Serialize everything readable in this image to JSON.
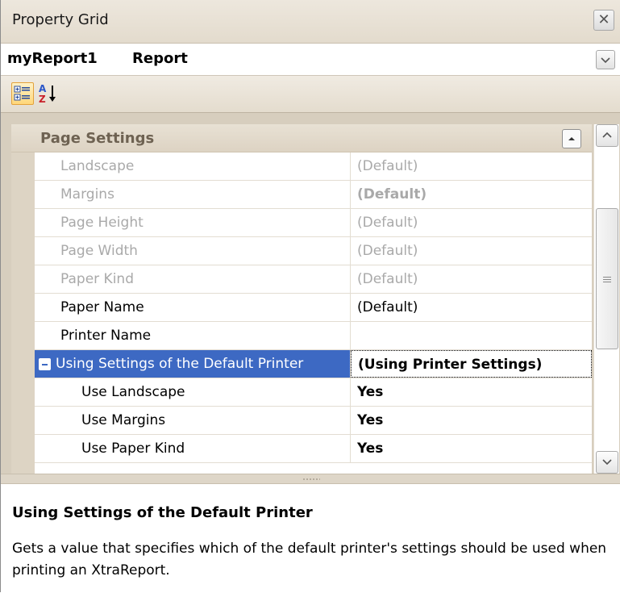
{
  "window": {
    "title": "Property Grid"
  },
  "object_selector": {
    "name": "myReport1",
    "type": "Report"
  },
  "toolbar": {
    "categorized_icon": "categorized-icon",
    "alphabetical_icon": "sort-az-icon"
  },
  "category": {
    "label": "Page Settings"
  },
  "properties": [
    {
      "name": "Landscape",
      "value": "(Default)"
    },
    {
      "name": "Margins",
      "value": "(Default)"
    },
    {
      "name": "Page Height",
      "value": "(Default)"
    },
    {
      "name": "Page Width",
      "value": "(Default)"
    },
    {
      "name": "Paper Kind",
      "value": "(Default)"
    },
    {
      "name": "Paper Name",
      "value": "(Default)"
    },
    {
      "name": "Printer Name",
      "value": ""
    },
    {
      "name": "Using Settings of the Default Printer",
      "value": "(Using Printer Settings)"
    },
    {
      "name": "Use Landscape",
      "value": "Yes"
    },
    {
      "name": "Use Margins",
      "value": "Yes"
    },
    {
      "name": "Use Paper Kind",
      "value": "Yes"
    }
  ],
  "description": {
    "title": "Using Settings of the Default Printer",
    "text": "Gets a value that specifies which of the default printer's settings should be used when printing an XtraReport."
  },
  "colors": {
    "selection": "#3d69c3",
    "disabled_text": "#a9a9a9",
    "category_text": "#6e6252"
  }
}
